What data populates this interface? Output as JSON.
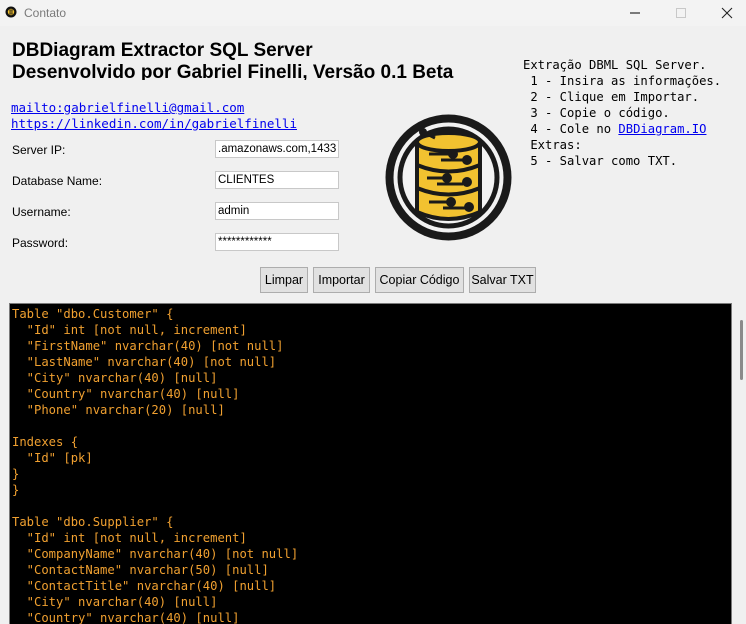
{
  "window": {
    "title": "Contato"
  },
  "header": {
    "line1": "DBDiagram Extractor SQL Server",
    "line2": "Desenvolvido por Gabriel Finelli, Versão 0.1 Beta"
  },
  "links": {
    "email": "mailto:gabrielfinelli@gmail.com",
    "linkedin": "https://linkedin.com/in/gabrielfinelli"
  },
  "form": {
    "server_label": "Server IP:",
    "server_value": ".amazonaws.com,1433",
    "db_label": "Database Name:",
    "db_value": "CLIENTES",
    "user_label": "Username:",
    "user_value": "admin",
    "pass_label": "Password:",
    "pass_value": "************"
  },
  "instructions": {
    "title": "Extração DBML SQL Server.",
    "step1": " 1 - Insira as informações.",
    "step2": " 2 - Clique em Importar.",
    "step3": " 3 - Copie o código.",
    "step4_prefix": " 4 - Cole no ",
    "step4_link": "DBDiagram.IO",
    "extras": " Extras:",
    "step5": " 5 - Salvar como TXT."
  },
  "buttons": {
    "limpar": "Limpar",
    "importar": "Importar",
    "copiar": "Copiar Código",
    "salvar": "Salvar TXT"
  },
  "code": {
    "lines": [
      "Table \"dbo.Customer\" {",
      "  \"Id\" int [not null, increment]",
      "  \"FirstName\" nvarchar(40) [not null]",
      "  \"LastName\" nvarchar(40) [not null]",
      "  \"City\" nvarchar(40) [null]",
      "  \"Country\" nvarchar(40) [null]",
      "  \"Phone\" nvarchar(20) [null]",
      "",
      "Indexes {",
      "  \"Id\" [pk]",
      "}",
      "}",
      "",
      "Table \"dbo.Supplier\" {",
      "  \"Id\" int [not null, increment]",
      "  \"CompanyName\" nvarchar(40) [not null]",
      "  \"ContactName\" nvarchar(50) [null]",
      "  \"ContactTitle\" nvarchar(40) [null]",
      "  \"City\" nvarchar(40) [null]",
      "  \"Country\" nvarchar(40) [null]"
    ]
  },
  "colors": {
    "code_background": "#000000",
    "code_text": "#f0a030",
    "link": "#0000ee",
    "logo_gold": "#f2c230",
    "logo_dark": "#1a1a1a"
  }
}
